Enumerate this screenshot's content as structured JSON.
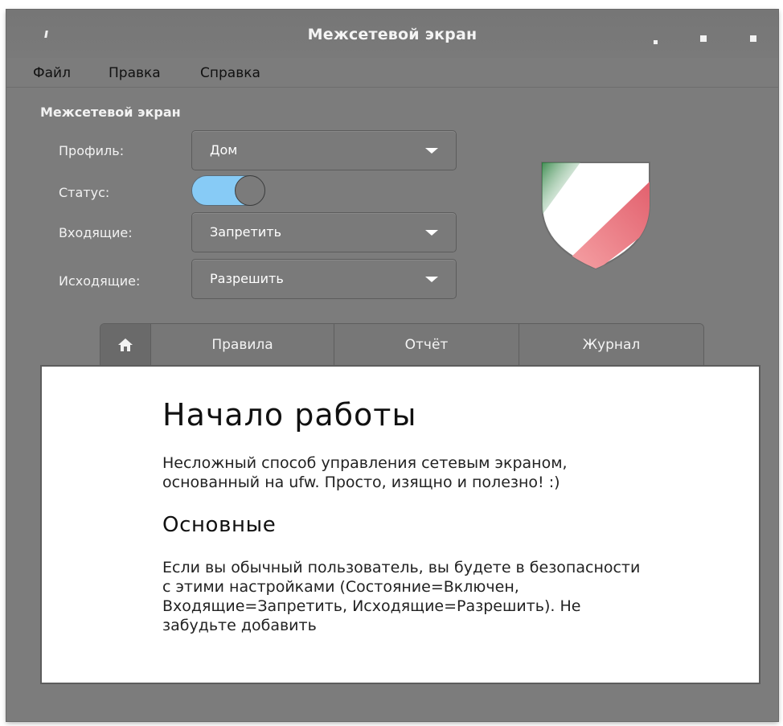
{
  "window": {
    "title": "Межсетевой экран"
  },
  "menubar": {
    "items": [
      "Файл",
      "Правка",
      "Справка"
    ]
  },
  "firewall": {
    "section_title": "Межсетевой экран",
    "profile": {
      "label": "Профиль:",
      "value": "Дом"
    },
    "status": {
      "label": "Статус:",
      "on": true
    },
    "incoming": {
      "label": "Входящие:",
      "value": "Запретить"
    },
    "outgoing": {
      "label": "Исходящие:",
      "value": "Разрешить"
    }
  },
  "tabs": [
    "Правила",
    "Отчёт",
    "Журнал"
  ],
  "content": {
    "heading": "Начало работы",
    "intro": "Несложный способ управления сетевым экраном, основанный на ufw. Просто, изящно и полезно! :)",
    "subheading": "Основные",
    "body": "Если вы обычный пользователь, вы будете в безопасности с этими настройками (Состояние=Включен, Входящие=Запретить, Исходящие=Разрешить). Не забудьте добавить"
  },
  "colors": {
    "window_bg": "#7c7c7c",
    "toggle_on": "#87cbf6",
    "shield_green": "#2e8b3a",
    "shield_red": "#e0707a"
  },
  "icons": {
    "app": "app-icon",
    "home_tab": "home-icon",
    "shield": "shield-icon"
  }
}
